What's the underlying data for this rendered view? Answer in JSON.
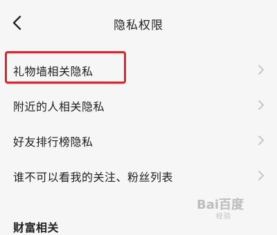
{
  "header": {
    "title": "隐私权限",
    "back_icon": "chevron-left-icon"
  },
  "list": {
    "items": [
      {
        "label": "礼物墙相关隐私",
        "highlighted": true
      },
      {
        "label": "附近的人相关隐私"
      },
      {
        "label": "好友排行榜隐私"
      },
      {
        "label": "谁不可以看我的关注、粉丝列表"
      }
    ],
    "chevron_icon": "chevron-right-icon"
  },
  "section": {
    "title": "财富相关"
  },
  "watermark": {
    "brand": "Bai百度",
    "sub": "经验"
  },
  "colors": {
    "background": "#f6f6f6",
    "highlight_border": "#e0242a",
    "chevron": "#bdbdbd"
  }
}
